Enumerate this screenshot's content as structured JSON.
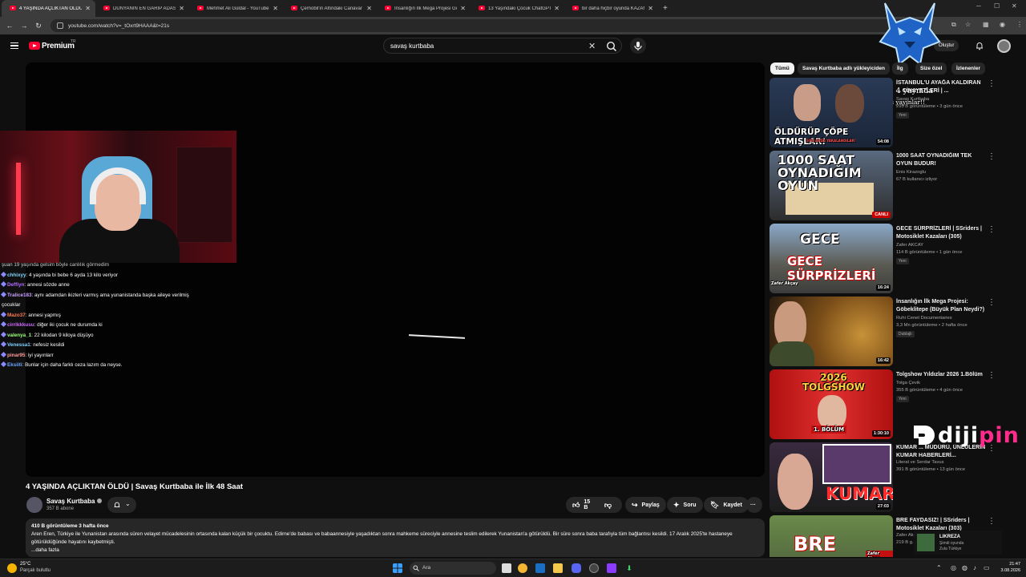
{
  "browser": {
    "tabs": [
      {
        "title": "4 YAŞINDA AÇLIKTAN ÖLDÜ | S",
        "active": true
      },
      {
        "title": "DÜNYANIN EN GARİP ADASINI",
        "active": false
      },
      {
        "title": "Mehmet Ali Güldal - YouTube",
        "active": false
      },
      {
        "title": "Çernobil'in Altındaki Canavar",
        "active": false
      },
      {
        "title": "İnsanlığın İlk Mega Projesi Göb",
        "active": false
      },
      {
        "title": "13 Yaşındaki Çocuk ChatGPT ile",
        "active": false
      },
      {
        "title": "bir daha hiçbir oyunda KAZAN",
        "active": false
      }
    ],
    "new_tab": "+",
    "url": "youtube.com/watch?v=_tOxrt9HAAA&t=21s"
  },
  "masthead": {
    "brand": "Premium",
    "region": "TR",
    "search_value": "savaş kurtbaba",
    "create_label": "Oluştur"
  },
  "overlay": {
    "streamer_tag": "pinar95",
    "streamer_tag_suffix": "4 yayında",
    "streamer_sub": "iyi yayınlar!!",
    "watermark_main": "diji",
    "watermark_accent": "pin"
  },
  "chat": {
    "top_partial": "şuan 19 yaşında gelsim böyle canlılık görmedim",
    "messages": [
      {
        "user": "chhixyy",
        "text": "4 yaşında bi bebe 6 ayda 13 kilo veriyor",
        "color": "#7ed6ff"
      },
      {
        "user": "Deffiyn",
        "text": "annesi sözde anne",
        "color": "#b36cff"
      },
      {
        "user": "Tralice183",
        "text": "aynı adamdan ikizleri varmış ama yunanistanda başka aileye verilmiş çocuklar",
        "color": "#c9a0ff"
      },
      {
        "user": "Mazo37",
        "text": "annesi yapmış",
        "color": "#ff7b4d"
      },
      {
        "user": "cirrikkkusu",
        "text": "diğer iki çocuk ne durumda ki",
        "color": "#d06bff"
      },
      {
        "user": "valenya_1",
        "text": "22 kilodan 9 kiloya düşüyo",
        "color": "#9cff7a"
      },
      {
        "user": "Venessa1",
        "text": "nefesiz kesildi",
        "color": "#7fd2ff"
      },
      {
        "user": "pinar95",
        "text": "iyi yayınlarr",
        "color": "#ff9b9b"
      },
      {
        "user": "Eksiiti",
        "text": "Bunlar için daha farklı ceza lazım da neyse.",
        "color": "#6aa7ff"
      }
    ]
  },
  "video": {
    "title": "4 YAŞINDA AÇLIKTAN ÖLDÜ | Savaş Kurtbaba ile İlk 48 Saat",
    "channel": "Savaş Kurtbaba",
    "subscribers": "357 B abone",
    "likes": "15 B",
    "share_label": "Paylaş",
    "ask_label": "Soru",
    "save_label": "Kaydet",
    "more_label": "···",
    "description": {
      "meta": "410 B görüntüleme  3 hafta önce",
      "text": "Aren Eren, Türkiye ile Yunanistan arasında süren velayet mücadelesinin ortasında kalan küçük bir çocuktu. Edirne'de babası ve babaannesiyle yaşadıktan sonra mahkeme süreciyle annesine teslim edilerek Yunanistan'a götürüldü. Bir süre sonra baba tarafıyla tüm bağlantısı kesildi. 17 Aralık 2025'te hastaneye götürüldüğünde hayatını kaybetmişti.",
      "more": "...daha fazla"
    }
  },
  "chips": [
    {
      "label": "Tümü",
      "active": true
    },
    {
      "label": "Savaş Kurtbaba adlı yükleyiciden",
      "active": false
    },
    {
      "label": "İlg",
      "active": false
    },
    {
      "label": "Size özel",
      "active": false
    },
    {
      "label": "İzlenenler",
      "active": false
    }
  ],
  "recommendations": [
    {
      "title": "İSTANBUL'U AYAĞA KALDIRAN ... CİNAYETLERİ | ...",
      "channel": "Savaş Kurtbaba",
      "views": "295 B görüntüleme • 3 gün önce",
      "badge": "Yeni",
      "duration": "54:08",
      "thumb_text": "ÖLDÜRÜP ÇÖPE ATMIŞLAR!",
      "thumb_sub": "SON ANDA YAKALANDILAR!"
    },
    {
      "title": "1000 SAAT OYNADIĞIM TEK OYUN BUDUR!",
      "channel": "Enis Kirazoglu",
      "views": "67 B kullanıcı izliyor",
      "badge": "",
      "duration": "CANLI",
      "thumb_text": "1000 SAAT OYNADIĞIM OYUN",
      "thumb_sub": ""
    },
    {
      "title": "GECE SÜRPRİZLERİ | SSriders | Motosiklet Kazaları (305)",
      "channel": "Zafer AKCAY",
      "views": "114 B görüntüleme • 1 gün önce",
      "badge": "Yeni",
      "duration": "16:24",
      "thumb_text": "GECE SÜRPRİZLERİ",
      "thumb_sub": "Zafer Akçay"
    },
    {
      "title": "İnsanlığın İlk Mega Projesi: Göbeklitepe (Büyük Plan Neydi?)",
      "channel": "Ruhi Cenet Documentaries",
      "views": "3,3 Mn görüntüleme • 2 hafta önce",
      "badge": "Dublajlı",
      "duration": "16:42",
      "thumb_text": "",
      "thumb_sub": ""
    },
    {
      "title": "Tolgshow Yıldızlar 2026 1.Bölüm",
      "channel": "Tolga Çevik",
      "views": "355 B görüntüleme • 4 gün önce",
      "badge": "Yeni",
      "duration": "1:30:10",
      "thumb_text": "2026 TOLGSHOW",
      "thumb_sub": "1. BÖLÜM"
    },
    {
      "title": "KUMAR ... MÜDÜRÜ, ÜNLÜLERİN KUMAR HABERLERİ...",
      "channel": "Literat ve Serdar Tavus",
      "views": "391 B görüntüleme • 13 gün önce",
      "badge": "",
      "duration": "27:03",
      "thumb_text": "KUMAR",
      "thumb_sub": ""
    },
    {
      "title": "BRE FAYDASIZ! | SSriders | Motosiklet Kazaları (303)",
      "channel": "Zafer Akçay",
      "views": "219 B g...",
      "badge": "",
      "duration": "",
      "thumb_text": "BRE",
      "thumb_sub": "Zafer Akçay"
    }
  ],
  "toast": {
    "title": "LIKREZA",
    "sub": "Şimdi oyunda",
    "sub2": "Zula Türkiye"
  },
  "taskbar": {
    "temp": "25°C",
    "weather": "Parçalı bulutlu",
    "search": "Ara",
    "time": "21:47",
    "date": "3.08.2026"
  },
  "colors": {
    "yt_red": "#ff0033",
    "bg": "#0f0f0f",
    "surface": "#272727"
  }
}
